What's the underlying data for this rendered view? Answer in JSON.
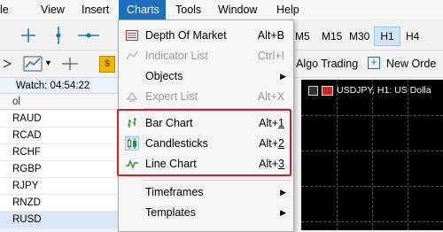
{
  "menubar": {
    "items": [
      {
        "label": "File",
        "visible": "le"
      },
      {
        "label": "View"
      },
      {
        "label": "Insert"
      },
      {
        "label": "Charts"
      },
      {
        "label": "Tools"
      },
      {
        "label": "Window"
      },
      {
        "label": "Help"
      }
    ]
  },
  "toolbar": {
    "timeframes": [
      "M5",
      "M15",
      "M30",
      "H1",
      "H4"
    ],
    "active_timeframe": "H1",
    "algo_trading": "Algo Trading",
    "new_order": "New Orde"
  },
  "market_watch": {
    "header": "Watch: 04:54:22",
    "column": "ol",
    "symbols": [
      "RAUD",
      "RCAD",
      "RCHF",
      "RGBP",
      "RJPY",
      "RNZD",
      "RUSD"
    ]
  },
  "chart": {
    "title": "USDJPY, H1:  US Dolla"
  },
  "charts_menu": {
    "items": [
      {
        "label": "Depth Of Market",
        "shortcut": "Alt+B",
        "icon": "depth-of-market-icon",
        "enabled": true
      },
      {
        "label": "Indicator List",
        "shortcut": "Ctrl+I",
        "icon": "indicator-list-icon",
        "enabled": false
      },
      {
        "label": "Objects",
        "submenu": true,
        "enabled": true
      },
      {
        "label": "Expert List",
        "shortcut": "Alt+X",
        "icon": "expert-list-icon",
        "enabled": false
      },
      {
        "label": "Bar Chart",
        "shortcut": "Alt+1",
        "icon": "bar-chart-icon",
        "enabled": true
      },
      {
        "label": "Candlesticks",
        "shortcut": "Alt+2",
        "icon": "candlesticks-icon",
        "enabled": true
      },
      {
        "label": "Line Chart",
        "shortcut": "Alt+3",
        "icon": "line-chart-icon",
        "enabled": true
      },
      {
        "label": "Timeframes",
        "submenu": true,
        "enabled": true
      },
      {
        "label": "Templates",
        "submenu": true,
        "enabled": true
      }
    ],
    "highlight_color": "#d21f26"
  },
  "colors": {
    "menu_active": "#1f6fbf",
    "disabled_text": "#9a9a9a"
  }
}
